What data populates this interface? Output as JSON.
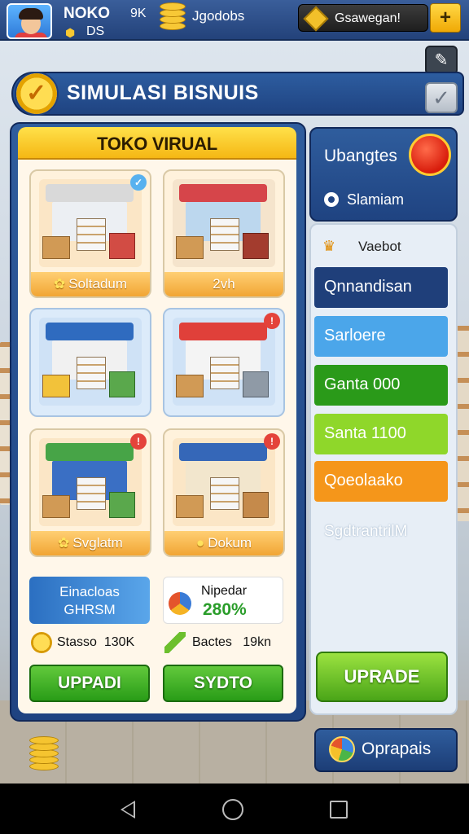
{
  "topbar": {
    "player_name": "NOKO",
    "player_level": "DS",
    "stat_value": "9K",
    "currency_label": "Jgodobs",
    "resource_label": "Gsawegan!",
    "add_label": "+"
  },
  "header": {
    "title": "SIMULASI BISNUIS"
  },
  "main_panel": {
    "title": "TOKO VIRUAL",
    "cards": [
      {
        "label": "Soltadum",
        "theme": "#fff2dc"
      },
      {
        "label": "2vh",
        "theme": "#fff2dc"
      },
      {
        "label": "",
        "theme": "#dcebfa"
      },
      {
        "label": "",
        "theme": "#dcebfa"
      },
      {
        "label": "Svglatm",
        "theme": "#fff2dc"
      },
      {
        "label": "Dokum",
        "theme": "#fff2dc"
      }
    ],
    "stat_left": {
      "line1": "Einacloas",
      "line2": "GHRSM"
    },
    "stat_right": {
      "label": "Nipedar",
      "value": "280%"
    },
    "money_left": {
      "label": "Stasso",
      "value": "130K"
    },
    "money_right": {
      "label": "Bactes",
      "value": "19kn"
    },
    "btn_left": "UPPADI",
    "btn_right": "SYDTO"
  },
  "right_panel": {
    "title": "Ubangtes",
    "subtitle": "Slamiam",
    "list_header": "Vaebot",
    "items": [
      {
        "label": "Qnnandisan",
        "color": "#1f3f7a"
      },
      {
        "label": "Sarloere",
        "color": "#4ba6ea"
      },
      {
        "label": "Ganta 000",
        "color": "#2a9a19"
      },
      {
        "label": "Santa 1100",
        "color": "#8fd72a"
      },
      {
        "label": "Qoeolaako",
        "color": "#f5961a"
      }
    ],
    "plain_item": "SgdtrantrilM",
    "upgrade_label": "UPRADE"
  },
  "bottom": {
    "button_label": "Oprapais"
  },
  "colors": {
    "panel_blue": "#1f4381",
    "title_yellow": "#f5b714",
    "button_green": "#299c17"
  }
}
